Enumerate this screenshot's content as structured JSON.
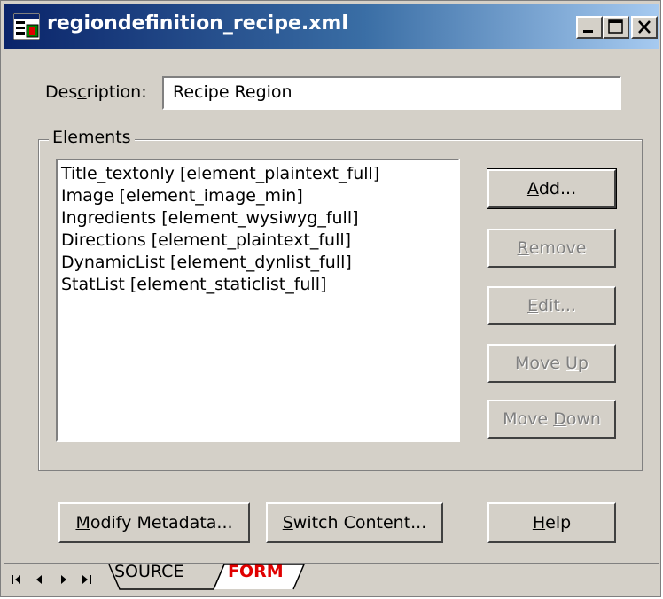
{
  "window": {
    "title": "regiondefinition_recipe.xml"
  },
  "description": {
    "label_pre": "Des",
    "label_ul": "c",
    "label_post": "ription:",
    "value": "Recipe Region"
  },
  "elements": {
    "group_label": "Elements",
    "items": [
      "Title_textonly [element_plaintext_full]",
      "Image [element_image_min]",
      "Ingredients [element_wysiwyg_full]",
      "Directions [element_plaintext_full]",
      "DynamicList [element_dynlist_full]",
      "StatList [element_staticlist_full]"
    ]
  },
  "buttons": {
    "add": {
      "ul": "A",
      "rest": "dd..."
    },
    "remove": {
      "ul": "R",
      "rest": "emove"
    },
    "edit": {
      "ul": "E",
      "rest": "dit..."
    },
    "move_up": {
      "pre": "Move ",
      "ul": "U",
      "rest": "p"
    },
    "move_down": {
      "pre": "Move ",
      "ul": "D",
      "rest": "own"
    },
    "modify_metadata": {
      "ul": "M",
      "rest": "odify Metadata..."
    },
    "switch_content": {
      "ul": "S",
      "rest": "witch Content..."
    },
    "help": {
      "ul": "H",
      "rest": "elp"
    }
  },
  "tabs": {
    "source": "SOURCE",
    "form": "FORM",
    "accent": "#e00000"
  }
}
